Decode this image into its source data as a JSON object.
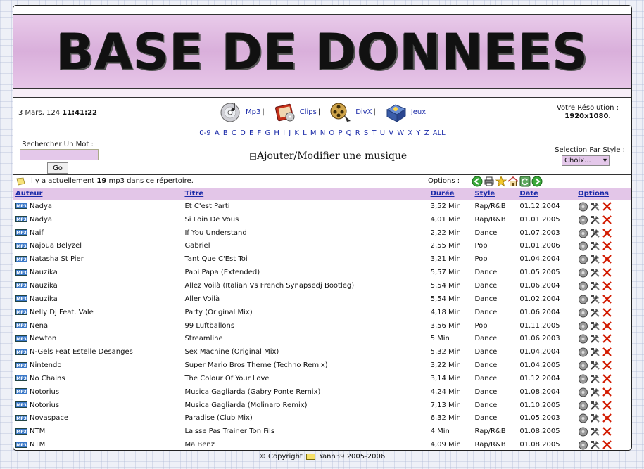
{
  "banner": {
    "title": "BASE DE DONNEES"
  },
  "info": {
    "date": "3 Mars, 124",
    "time": "11:41:22",
    "categories": [
      {
        "label": "Mp3",
        "icon": "cd-icon"
      },
      {
        "label": "Clips",
        "icon": "video-book-icon"
      },
      {
        "label": "DivX",
        "icon": "film-reel-icon"
      },
      {
        "label": "Jeux",
        "icon": "game-box-icon"
      }
    ],
    "separator": "|",
    "resolution_label": "Votre Résolution :",
    "resolution_value": "1920x1080"
  },
  "alphabet": [
    "0-9",
    "A",
    "B",
    "C",
    "D",
    "E",
    "F",
    "G",
    "H",
    "I",
    "J",
    "K",
    "L",
    "M",
    "N",
    "O",
    "P",
    "Q",
    "R",
    "S",
    "T",
    "U",
    "V",
    "W",
    "X",
    "Y",
    "Z",
    "ALL"
  ],
  "search": {
    "label": "Rechercher Un Mot :",
    "value": "",
    "button": "Go",
    "add_modify": "Ajouter/Modifier une musique",
    "style_label": "Selection Par Style :",
    "style_value": "Choix..."
  },
  "status": {
    "prefix": "Il y a actuellement",
    "count": "19",
    "suffix": "mp3 dans ce répertoire.",
    "options_label": "Options :"
  },
  "table": {
    "headers": {
      "auteur": "Auteur",
      "titre": "Titre",
      "duree": "Durée",
      "style": "Style",
      "date": "Date",
      "options": "Options"
    },
    "badge": "MP3",
    "rows": [
      {
        "auteur": "Nadya",
        "titre": "Et C'est Parti",
        "duree": "3,52 Min",
        "style": "Rap/R&B",
        "date": "01.12.2004"
      },
      {
        "auteur": "Nadya",
        "titre": "Si Loin De Vous",
        "duree": "4,01 Min",
        "style": "Rap/R&B",
        "date": "01.01.2005"
      },
      {
        "auteur": "Naif",
        "titre": "If You Understand",
        "duree": "2,22 Min",
        "style": "Dance",
        "date": "01.07.2003"
      },
      {
        "auteur": "Najoua Belyzel",
        "titre": "Gabriel",
        "duree": "2,55 Min",
        "style": "Pop",
        "date": "01.01.2006"
      },
      {
        "auteur": "Natasha St Pier",
        "titre": "Tant Que C'Est Toi",
        "duree": "3,21 Min",
        "style": "Pop",
        "date": "01.04.2004"
      },
      {
        "auteur": "Nauzika",
        "titre": "Papi Papa (Extended)",
        "duree": "5,57 Min",
        "style": "Dance",
        "date": "01.05.2005"
      },
      {
        "auteur": "Nauzika",
        "titre": "Allez Voilà (Italian Vs French Synapsedj Bootleg)",
        "duree": "5,54 Min",
        "style": "Dance",
        "date": "01.06.2004"
      },
      {
        "auteur": "Nauzika",
        "titre": "Aller Voilà",
        "duree": "5,54 Min",
        "style": "Dance",
        "date": "01.02.2004"
      },
      {
        "auteur": "Nelly Dj Feat. Vale",
        "titre": "Party (Original Mix)",
        "duree": "4,18 Min",
        "style": "Dance",
        "date": "01.06.2004"
      },
      {
        "auteur": "Nena",
        "titre": "99 Luftballons",
        "duree": "3,56 Min",
        "style": "Pop",
        "date": "01.11.2005"
      },
      {
        "auteur": "Newton",
        "titre": "Streamline",
        "duree": "5 Min",
        "style": "Dance",
        "date": "01.06.2003"
      },
      {
        "auteur": "N-Gels Feat Estelle Desanges",
        "titre": "Sex Machine (Original Mix)",
        "duree": "5,32 Min",
        "style": "Dance",
        "date": "01.04.2004"
      },
      {
        "auteur": "Nintendo",
        "titre": "Super Mario Bros Theme (Techno Remix)",
        "duree": "3,22 Min",
        "style": "Dance",
        "date": "01.04.2005"
      },
      {
        "auteur": "No Chains",
        "titre": "The Colour Of Your Love",
        "duree": "3,14 Min",
        "style": "Dance",
        "date": "01.12.2004"
      },
      {
        "auteur": "Notorius",
        "titre": "Musica Gagliarda (Gabry Ponte Remix)",
        "duree": "4,24 Min",
        "style": "Dance",
        "date": "01.08.2004"
      },
      {
        "auteur": "Notorius",
        "titre": "Musica Gagliarda (Molinaro Remix)",
        "duree": "7,13 Min",
        "style": "Dance",
        "date": "01.10.2005"
      },
      {
        "auteur": "Novaspace",
        "titre": "Paradise (Club Mix)",
        "duree": "6,32 Min",
        "style": "Dance",
        "date": "01.05.2003"
      },
      {
        "auteur": "NTM",
        "titre": "Laisse Pas Trainer Ton Fils",
        "duree": "4 Min",
        "style": "Rap/R&B",
        "date": "01.08.2005"
      },
      {
        "auteur": "NTM",
        "titre": "Ma Benz",
        "duree": "4,09 Min",
        "style": "Rap/R&B",
        "date": "01.08.2005"
      }
    ]
  },
  "footer": {
    "copyright": "© Copyright",
    "author": "Yann39 2005-2006"
  },
  "colors": {
    "header_bg": "#e3c6e8",
    "link": "#1a2aa8",
    "delete": "#d21a00"
  }
}
